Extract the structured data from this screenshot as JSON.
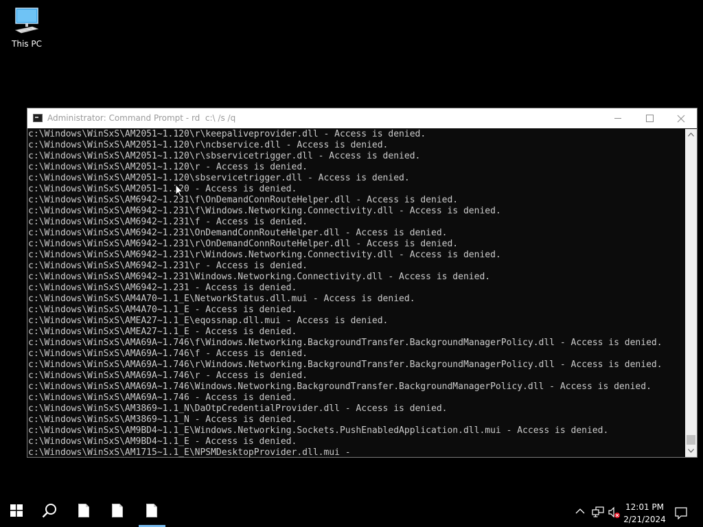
{
  "desktop": {
    "icons": [
      {
        "label": "This PC",
        "icon": "monitor-icon"
      }
    ]
  },
  "window": {
    "title": "Administrator: Command Prompt - rd  c:\\ /s /q",
    "controls": {
      "minimize": "minimize-icon",
      "maximize": "maximize-icon",
      "close": "close-icon"
    }
  },
  "console": {
    "lines": [
      "c:\\Windows\\WinSxS\\AM2051~1.120\\r\\keepaliveprovider.dll - Access is denied.",
      "c:\\Windows\\WinSxS\\AM2051~1.120\\r\\ncbservice.dll - Access is denied.",
      "c:\\Windows\\WinSxS\\AM2051~1.120\\r\\sbservicetrigger.dll - Access is denied.",
      "c:\\Windows\\WinSxS\\AM2051~1.120\\r - Access is denied.",
      "c:\\Windows\\WinSxS\\AM2051~1.120\\sbservicetrigger.dll - Access is denied.",
      "c:\\Windows\\WinSxS\\AM2051~1.120 - Access is denied.",
      "c:\\Windows\\WinSxS\\AM6942~1.231\\f\\OnDemandConnRouteHelper.dll - Access is denied.",
      "c:\\Windows\\WinSxS\\AM6942~1.231\\f\\Windows.Networking.Connectivity.dll - Access is denied.",
      "c:\\Windows\\WinSxS\\AM6942~1.231\\f - Access is denied.",
      "c:\\Windows\\WinSxS\\AM6942~1.231\\OnDemandConnRouteHelper.dll - Access is denied.",
      "c:\\Windows\\WinSxS\\AM6942~1.231\\r\\OnDemandConnRouteHelper.dll - Access is denied.",
      "c:\\Windows\\WinSxS\\AM6942~1.231\\r\\Windows.Networking.Connectivity.dll - Access is denied.",
      "c:\\Windows\\WinSxS\\AM6942~1.231\\r - Access is denied.",
      "c:\\Windows\\WinSxS\\AM6942~1.231\\Windows.Networking.Connectivity.dll - Access is denied.",
      "c:\\Windows\\WinSxS\\AM6942~1.231 - Access is denied.",
      "c:\\Windows\\WinSxS\\AM4A70~1.1_E\\NetworkStatus.dll.mui - Access is denied.",
      "c:\\Windows\\WinSxS\\AM4A70~1.1_E - Access is denied.",
      "c:\\Windows\\WinSxS\\AMEA27~1.1_E\\eqossnap.dll.mui - Access is denied.",
      "c:\\Windows\\WinSxS\\AMEA27~1.1_E - Access is denied.",
      "c:\\Windows\\WinSxS\\AMA69A~1.746\\f\\Windows.Networking.BackgroundTransfer.BackgroundManagerPolicy.dll - Access is denied.",
      "c:\\Windows\\WinSxS\\AMA69A~1.746\\f - Access is denied.",
      "c:\\Windows\\WinSxS\\AMA69A~1.746\\r\\Windows.Networking.BackgroundTransfer.BackgroundManagerPolicy.dll - Access is denied.",
      "c:\\Windows\\WinSxS\\AMA69A~1.746\\r - Access is denied.",
      "c:\\Windows\\WinSxS\\AMA69A~1.746\\Windows.Networking.BackgroundTransfer.BackgroundManagerPolicy.dll - Access is denied.",
      "c:\\Windows\\WinSxS\\AMA69A~1.746 - Access is denied.",
      "c:\\Windows\\WinSxS\\AM3869~1.1_N\\DaOtpCredentialProvider.dll - Access is denied.",
      "c:\\Windows\\WinSxS\\AM3869~1.1_N - Access is denied.",
      "c:\\Windows\\WinSxS\\AM9BD4~1.1_E\\Windows.Networking.Sockets.PushEnabledApplication.dll.mui - Access is denied.",
      "c:\\Windows\\WinSxS\\AM9BD4~1.1_E - Access is denied.",
      "c:\\Windows\\WinSxS\\AM1715~1.1_E\\NPSMDesktopProvider.dll.mui -"
    ],
    "foreground": "#cccccc",
    "background": "#0c0c0c"
  },
  "scrollbar": {
    "up": "chevron-up-icon",
    "down": "chevron-down-icon",
    "position": 0.97
  },
  "taskbar": {
    "items": [
      {
        "name": "start-button",
        "icon": "windows-logo-icon"
      },
      {
        "name": "search-button",
        "icon": "search-icon"
      },
      {
        "name": "taskbar-app-1",
        "icon": "document-icon"
      },
      {
        "name": "taskbar-app-2",
        "icon": "document-icon"
      },
      {
        "name": "taskbar-app-3",
        "icon": "document-icon",
        "active": true
      }
    ],
    "tray": {
      "show_hidden": "^",
      "network": "network-icon",
      "volume": "volume-muted-icon",
      "time": "12:01 PM",
      "date": "2/21/2024",
      "notification": "notification-icon"
    },
    "accent": "#76b9ed"
  }
}
